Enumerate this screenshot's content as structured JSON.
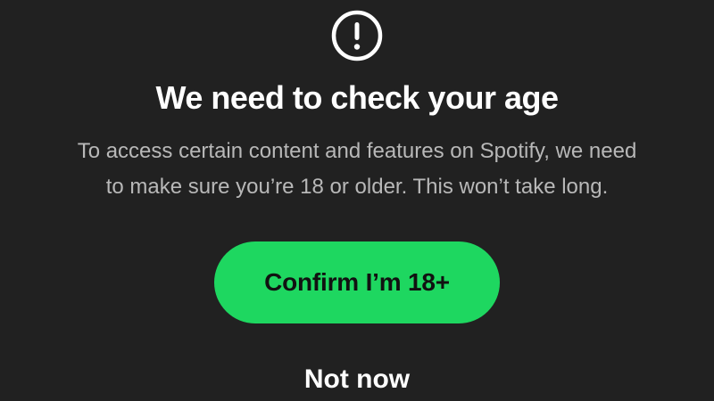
{
  "dialog": {
    "icon": "exclamation-circle-icon",
    "title": "We need to check your age",
    "description_line1": "To access certain content and features on Spotify, we need",
    "description_line2": "to make sure you’re 18 or older. This won’t take long.",
    "confirm_label": "Confirm I’m 18+",
    "dismiss_label": "Not now"
  },
  "colors": {
    "background": "#212121",
    "accent": "#1ed760",
    "text_primary": "#ffffff",
    "text_secondary": "#b8b8b8"
  }
}
